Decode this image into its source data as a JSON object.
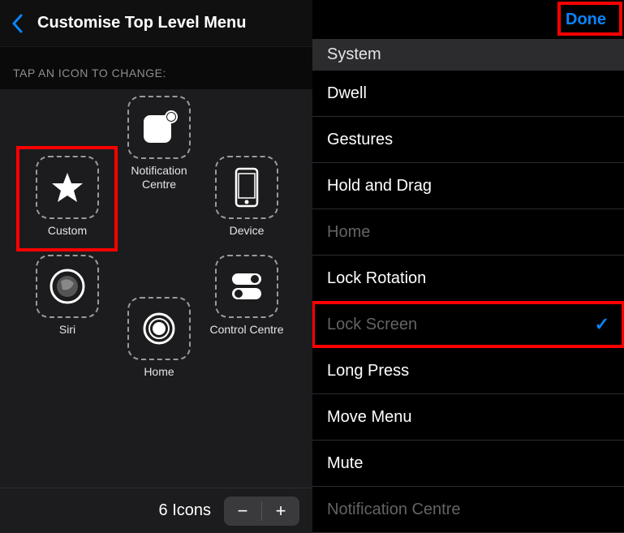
{
  "header": {
    "title": "Customise Top Level Menu"
  },
  "hint": "TAP AN ICON TO CHANGE:",
  "menuItems": {
    "notification": {
      "label": "Notification Centre"
    },
    "custom": {
      "label": "Custom"
    },
    "device": {
      "label": "Device"
    },
    "siri": {
      "label": "Siri"
    },
    "home": {
      "label": "Home"
    },
    "control": {
      "label": "Control Centre"
    }
  },
  "bottom": {
    "count": "6 Icons"
  },
  "rightHeader": {
    "done": "Done"
  },
  "section": "System",
  "list": {
    "dwell": "Dwell",
    "gestures": "Gestures",
    "holdDrag": "Hold and Drag",
    "home": "Home",
    "lockRotation": "Lock Rotation",
    "lockScreen": "Lock Screen",
    "longPress": "Long Press",
    "moveMenu": "Move Menu",
    "mute": "Mute",
    "notificationCentre": "Notification Centre"
  }
}
